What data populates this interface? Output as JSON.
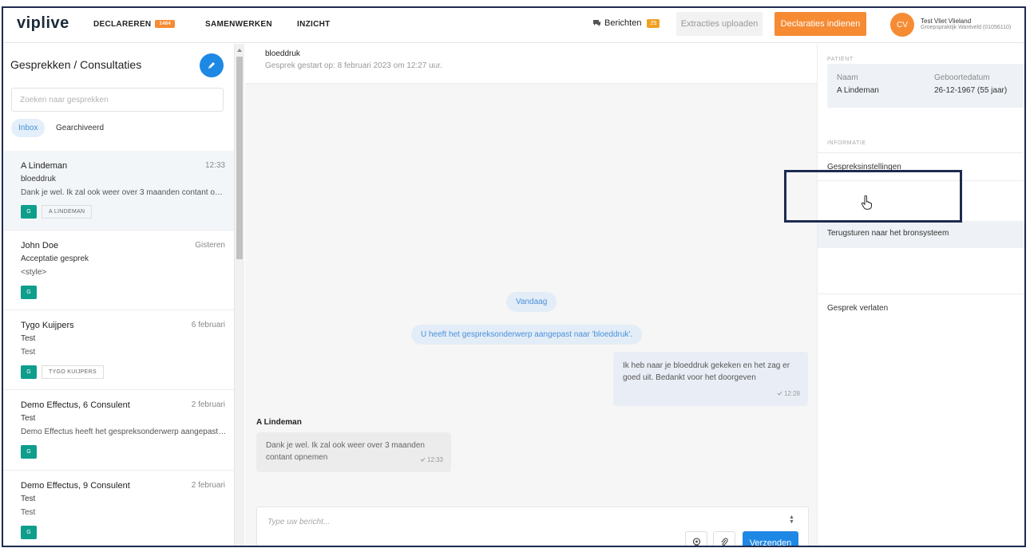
{
  "nav": {
    "logo": "viplive",
    "items": [
      {
        "label": "DECLAREREN",
        "badge": "1464"
      },
      {
        "label": "SAMENWERKEN"
      },
      {
        "label": "INZICHT"
      }
    ],
    "berichten_label": "Berichten",
    "berichten_count": "25",
    "extracties_label": "Extracties uploaden",
    "indienen_label": "Declaraties indienen",
    "avatar_initials": "CV",
    "user_name": "Test Vliet Vlieland",
    "user_org": "Groepspraktijk Wantveld (01056110)"
  },
  "sidebar": {
    "title": "Gesprekken / Consultaties",
    "search_placeholder": "Zoeken naar gesprekken",
    "tabs": [
      "Inbox",
      "Gearchiveerd"
    ],
    "conversations": [
      {
        "name": "A Lindeman",
        "time": "12:33",
        "subject": "bloeddruk",
        "preview": "Dank je wel. Ik zal ook weer over 3 maanden contant opnemen",
        "tag": "G",
        "patient_tag": "A LINDEMAN"
      },
      {
        "name": "John Doe",
        "time": "Gisteren",
        "subject": "Acceptatie gesprek",
        "preview": "<style>",
        "tag": "G",
        "patient_tag": ""
      },
      {
        "name": "Tygo Kuijpers",
        "time": "6 februari",
        "subject": "Test",
        "preview": "Test",
        "tag": "G",
        "patient_tag": "TYGO KUIJPERS"
      },
      {
        "name": "Demo Effectus, 6 Consulent",
        "time": "2 februari",
        "subject": "Test",
        "preview": "Demo Effectus heeft het gespreksonderwerp aangepast naar 'Test'",
        "tag": "G",
        "patient_tag": ""
      },
      {
        "name": "Demo Effectus, 9 Consulent",
        "time": "2 februari",
        "subject": "Test",
        "preview": "Test",
        "tag": "G",
        "patient_tag": ""
      }
    ]
  },
  "chat": {
    "title": "bloeddruk",
    "subtitle": "Gesprek gestart op: 8 februari 2023 om 12:27 uur.",
    "date_pill": "Vandaag",
    "system_message": "U heeft het gespreksonderwerp aangepast naar 'bloeddruk'.",
    "outgoing": {
      "text": "Ik heb naar je bloeddruk gekeken en het zag er goed uit. Bedankt voor het doorgeven",
      "time": "12:28"
    },
    "incoming": {
      "sender": "A Lindeman",
      "text": "Dank je wel. Ik zal ook weer over 3 maanden contant opnemen",
      "time": "12:33"
    },
    "composer_placeholder": "Type uw bericht...",
    "send_label": "Verzenden"
  },
  "right": {
    "patient_label": "PATIËNT",
    "name_label": "Naam",
    "name_value": "A Lindeman",
    "dob_label": "Geboortedatum",
    "dob_value": "26-12-1967 (55 jaar)",
    "info_label": "INFORMATIE",
    "settings_item": "Gespreksinstellingen",
    "return_item": "Terugsturen naar het bronsysteem",
    "leave_item": "Gesprek verlaten"
  },
  "colors": {
    "accent_orange": "#f68b33",
    "accent_blue": "#1e88e5",
    "tag_teal": "#0f9e8b",
    "highlight_frame": "#1d2b4f"
  }
}
